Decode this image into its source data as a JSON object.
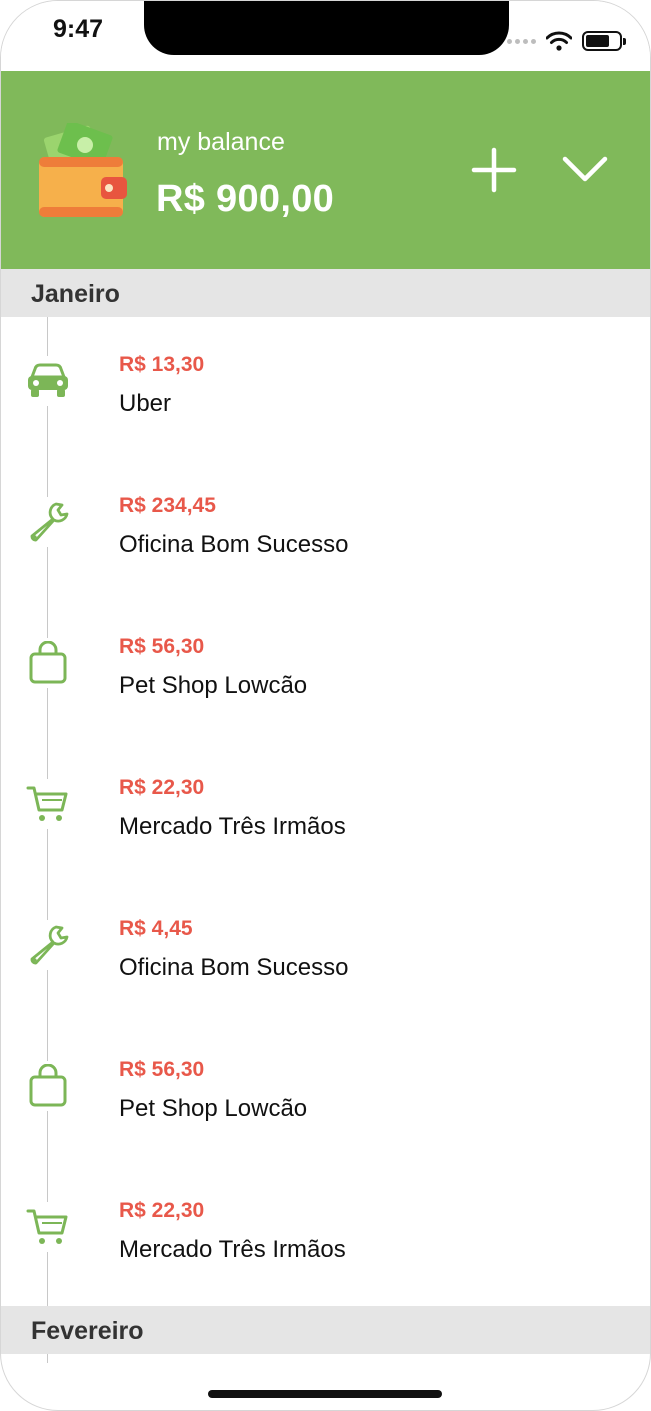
{
  "status_bar": {
    "time": "9:47"
  },
  "header": {
    "balance_label": "my balance",
    "balance_value": "R$ 900,00",
    "accent_color": "#80b95a"
  },
  "sections": [
    {
      "title": "Janeiro",
      "transactions": [
        {
          "amount": "R$ 13,30",
          "name": "Uber",
          "icon": "car-icon"
        },
        {
          "amount": "R$ 234,45",
          "name": "Oficina Bom Sucesso",
          "icon": "wrench-icon"
        },
        {
          "amount": "R$ 56,30",
          "name": "Pet Shop Lowcão",
          "icon": "shopping-bag-icon"
        },
        {
          "amount": "R$ 22,30",
          "name": "Mercado Três Irmãos",
          "icon": "cart-icon"
        },
        {
          "amount": "R$ 4,45",
          "name": "Oficina Bom Sucesso",
          "icon": "wrench-icon"
        },
        {
          "amount": "R$ 56,30",
          "name": "Pet Shop Lowcão",
          "icon": "shopping-bag-icon"
        },
        {
          "amount": "R$ 22,30",
          "name": "Mercado Três Irmãos",
          "icon": "cart-icon"
        }
      ]
    },
    {
      "title": "Fevereiro",
      "transactions": []
    }
  ],
  "colors": {
    "expense": "#e8584a",
    "icon": "#7cb657",
    "section_bg": "#e5e5e5"
  }
}
